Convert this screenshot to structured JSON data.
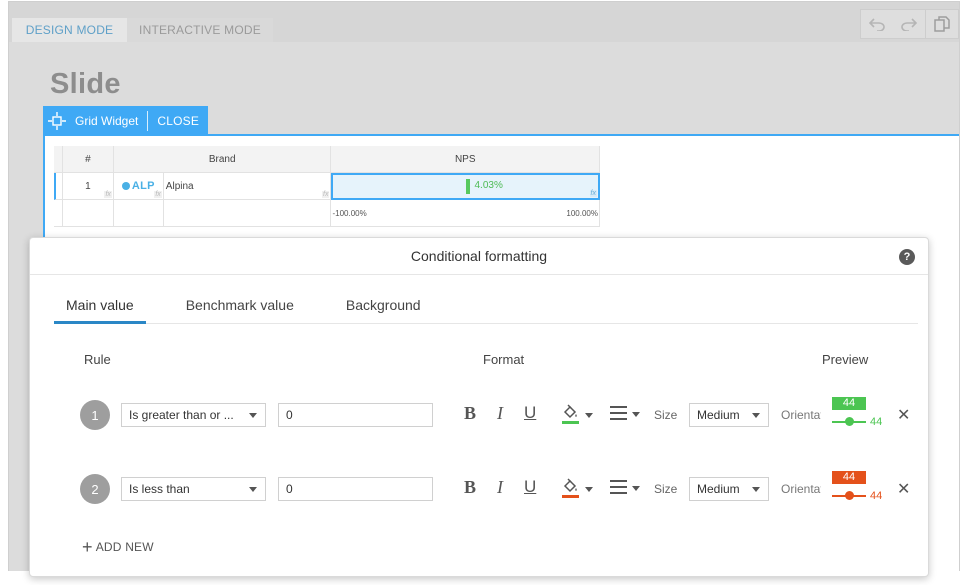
{
  "mode_tabs": {
    "design": "DESIGN MODE",
    "interactive": "INTERACTIVE MODE"
  },
  "toolbar": {
    "icons": [
      "undo-icon",
      "redo-icon",
      "copy-icon"
    ]
  },
  "slide": {
    "title": "Slide"
  },
  "widget": {
    "label": "Grid Widget",
    "close": "CLOSE"
  },
  "grid": {
    "headers": {
      "num": "#",
      "brand": "Brand",
      "nps": "NPS"
    },
    "rows": [
      {
        "num": "1",
        "logo": "ALP",
        "brand": "Alpina",
        "nps": "4.03%",
        "nps_value": 0.0403
      }
    ],
    "axis": {
      "min": "-100.00%",
      "max": "100.00%"
    },
    "fx": "fx"
  },
  "dialog": {
    "title": "Conditional formatting",
    "help": "?",
    "tabs": [
      "Main value",
      "Benchmark value",
      "Background"
    ],
    "active_tab": "Main value",
    "columns": {
      "rule": "Rule",
      "format": "Format",
      "preview": "Preview"
    },
    "rules": [
      {
        "num": "1",
        "condition": "Is greater than or ...",
        "value": "0",
        "size_label": "Size",
        "size": "Medium",
        "orientation": "Orientation",
        "preview": "44",
        "color": "#4cc552"
      },
      {
        "num": "2",
        "condition": "Is less than",
        "value": "0",
        "size_label": "Size",
        "size": "Medium",
        "orientation": "Orientation",
        "preview": "44",
        "color": "#e4511b"
      }
    ],
    "format_buttons": {
      "bold": "B",
      "italic": "I",
      "underline": "U"
    },
    "delete": "✕",
    "add_new": "ADD NEW",
    "add_new_icon": "+"
  },
  "colors": {
    "accent": "#3fa9f5",
    "tab_active": "#2a87c6",
    "positive": "#4cc552",
    "negative": "#e4511b"
  }
}
